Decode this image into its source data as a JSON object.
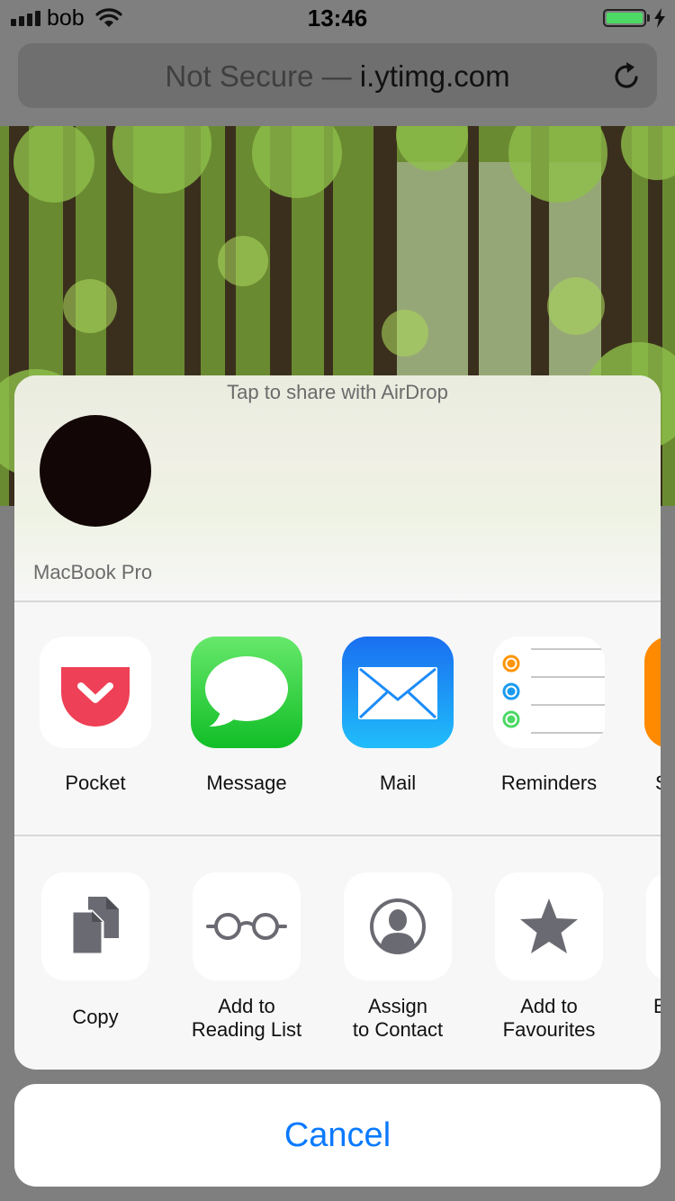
{
  "status_bar": {
    "carrier": "bob",
    "time": "13:46"
  },
  "url_bar": {
    "prefix": "Not Secure — ",
    "host": "i.ytimg.com"
  },
  "share_sheet": {
    "airdrop_title": "Tap to share with AirDrop",
    "device_name": "MacBook Pro",
    "apps": [
      {
        "label": "Pocket",
        "icon": "pocket-icon"
      },
      {
        "label": "Message",
        "icon": "message-icon"
      },
      {
        "label": "Mail",
        "icon": "mail-icon"
      },
      {
        "label": "Reminders",
        "icon": "reminders-icon"
      },
      {
        "label": "S",
        "icon": "partial-app-icon"
      }
    ],
    "actions": [
      {
        "label_line1": "Copy",
        "label_line2": "",
        "icon": "copy-icon"
      },
      {
        "label_line1": "Add to",
        "label_line2": "Reading List",
        "icon": "glasses-icon"
      },
      {
        "label_line1": "Assign",
        "label_line2": "to Contact",
        "icon": "contact-icon"
      },
      {
        "label_line1": "Add to",
        "label_line2": "Favourites",
        "icon": "star-icon"
      },
      {
        "label_line1": "",
        "label_line2": "B",
        "icon": "partial-action-icon"
      }
    ],
    "cancel_label": "Cancel"
  },
  "colors": {
    "accent": "#0a7aff",
    "pocket": "#ee4056",
    "message": "#3ecf4a",
    "mail": "#1d8cf8",
    "battery": "#4cd964"
  }
}
